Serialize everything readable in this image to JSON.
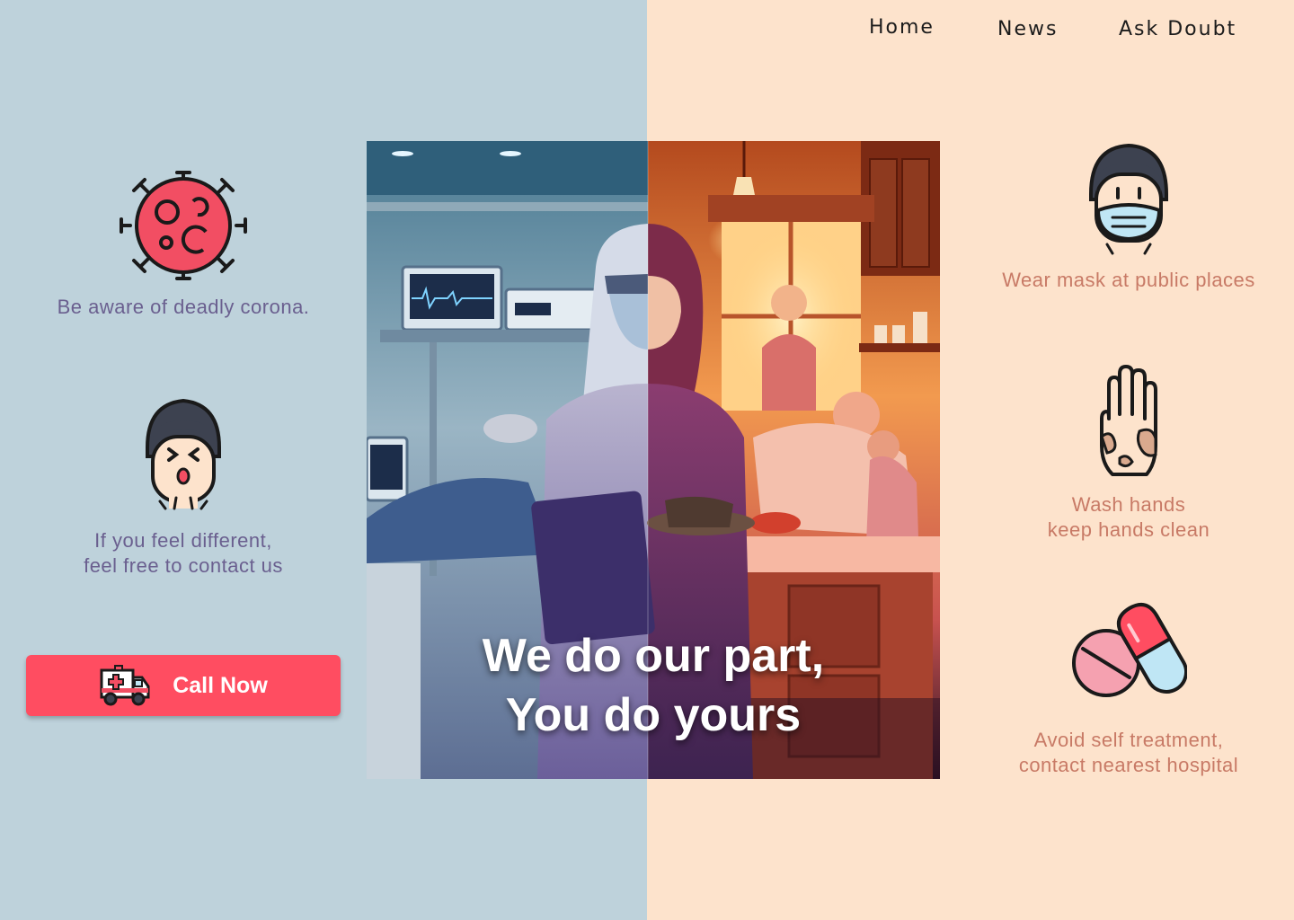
{
  "nav": {
    "items": [
      "Home",
      "News",
      "Ask Doubt"
    ]
  },
  "left": {
    "features": [
      {
        "icon": "virus-icon",
        "lines": [
          "Be aware of deadly corona."
        ]
      },
      {
        "icon": "sick-person-icon",
        "lines": [
          "If you feel different,",
          "feel free to contact us"
        ]
      }
    ],
    "call_button": {
      "label": "Call Now",
      "icon": "ambulance-icon"
    }
  },
  "hero": {
    "caption_lines": [
      "We do our part,",
      "You do yours"
    ]
  },
  "right": {
    "features": [
      {
        "icon": "mask-face-icon",
        "lines": [
          "Wear mask at public places"
        ]
      },
      {
        "icon": "hand-wash-icon",
        "lines": [
          "Wash hands",
          "keep hands clean"
        ]
      },
      {
        "icon": "pills-icon",
        "lines": [
          "Avoid self treatment,",
          "contact nearest hospital"
        ]
      }
    ]
  },
  "colors": {
    "left_bg": "#bed2db",
    "right_bg": "#fde3cc",
    "accent": "#ff4d61",
    "left_text": "#6a5f8f",
    "right_text": "#c87a66"
  }
}
